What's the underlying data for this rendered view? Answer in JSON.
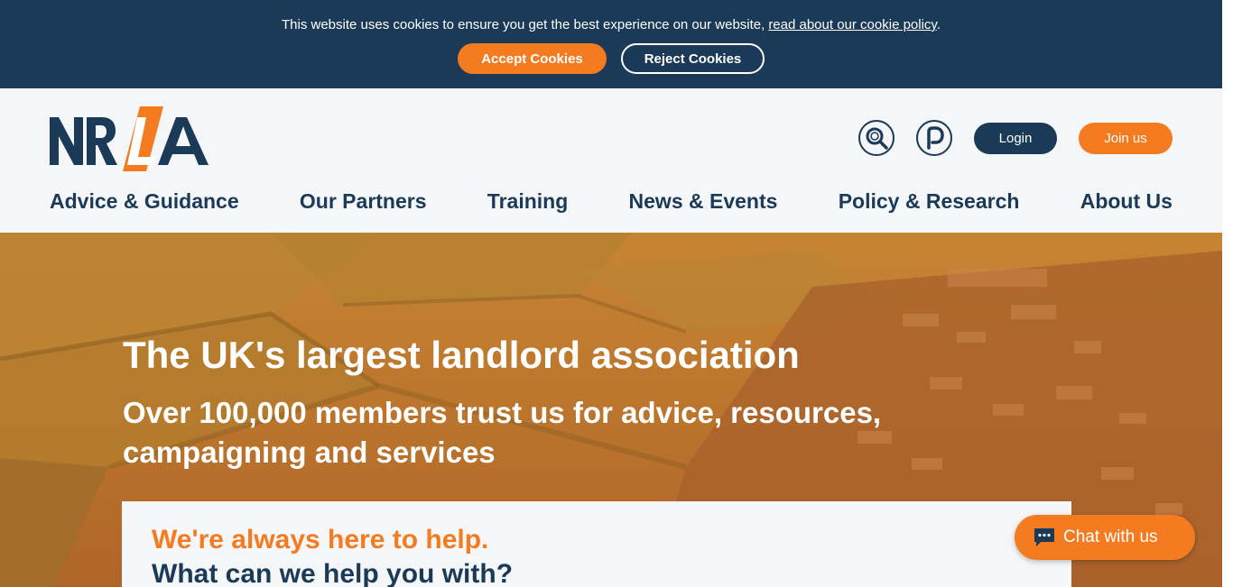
{
  "cookie_banner": {
    "message": "This website uses cookies to ensure you get the best experience on our website,",
    "policy_link": "read about our cookie policy",
    "period": ".",
    "accept_label": "Accept Cookies",
    "reject_label": "Reject Cookies"
  },
  "header": {
    "logo_text": "NRLA",
    "search_icon": "search-icon",
    "p_icon": "parking-p-icon",
    "login_label": "Login",
    "join_label": "Join us"
  },
  "nav": {
    "items": [
      {
        "label": "Advice & Guidance"
      },
      {
        "label": "Our Partners"
      },
      {
        "label": "Training"
      },
      {
        "label": "News & Events"
      },
      {
        "label": "Policy & Research"
      },
      {
        "label": "About Us"
      }
    ]
  },
  "hero": {
    "title": "The UK's largest landlord association",
    "subtitle": "Over 100,000 members trust us for advice, resources, campaigning and services"
  },
  "help_card": {
    "line1": "We're always here to help.",
    "line2": "What can we help you with?"
  },
  "chat": {
    "label": "Chat with us",
    "icon": "chat-bubble-icon"
  },
  "colors": {
    "navy": "#1b3a57",
    "orange": "#f47b20",
    "header_bg": "#f4f6f8"
  }
}
